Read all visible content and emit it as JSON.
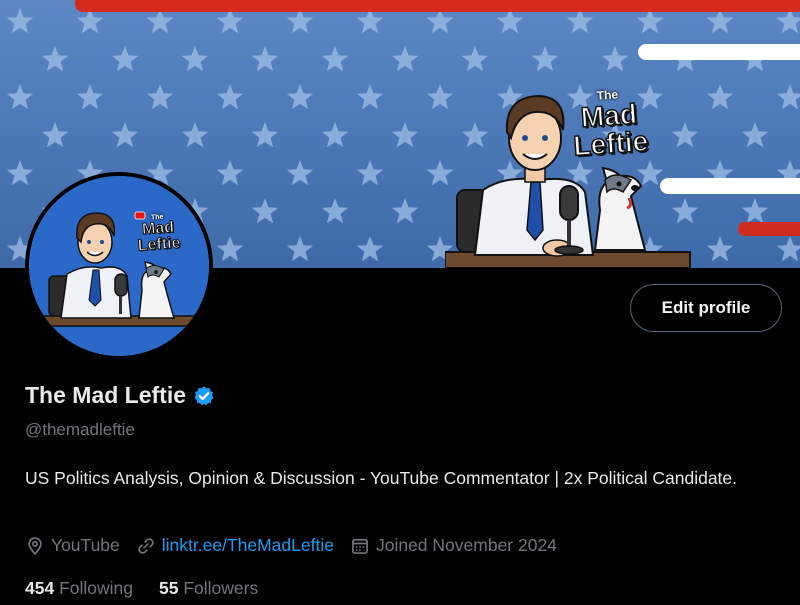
{
  "banner": {
    "logo_small": "The",
    "logo_line1": "Mad",
    "logo_line2": "Leftie"
  },
  "avatar": {
    "logo_small": "The",
    "logo_line1": "Mad",
    "logo_line2": "Leftie"
  },
  "header": {
    "edit_profile_label": "Edit profile"
  },
  "profile": {
    "display_name": "The Mad Leftie",
    "verified": true,
    "handle": "@themadleftie",
    "bio": "US Politics Analysis, Opinion & Discussion - YouTube Commentator | 2x Political Candidate.",
    "location": "YouTube",
    "link": "linktr.ee/TheMadLeftie",
    "joined": "Joined November 2024",
    "following_count": "454",
    "following_label": "Following",
    "followers_count": "55",
    "followers_label": "Followers"
  },
  "icons": {
    "verified": "verified-badge-icon",
    "location": "location-pin-icon",
    "link": "link-icon",
    "calendar": "calendar-icon"
  },
  "colors": {
    "background": "#000000",
    "accent_link": "#1d9bf0",
    "verified_badge": "#1d9bf0",
    "muted_text": "#71767b",
    "banner_blue": "#4f7bbb",
    "banner_red": "#d62a1d"
  }
}
